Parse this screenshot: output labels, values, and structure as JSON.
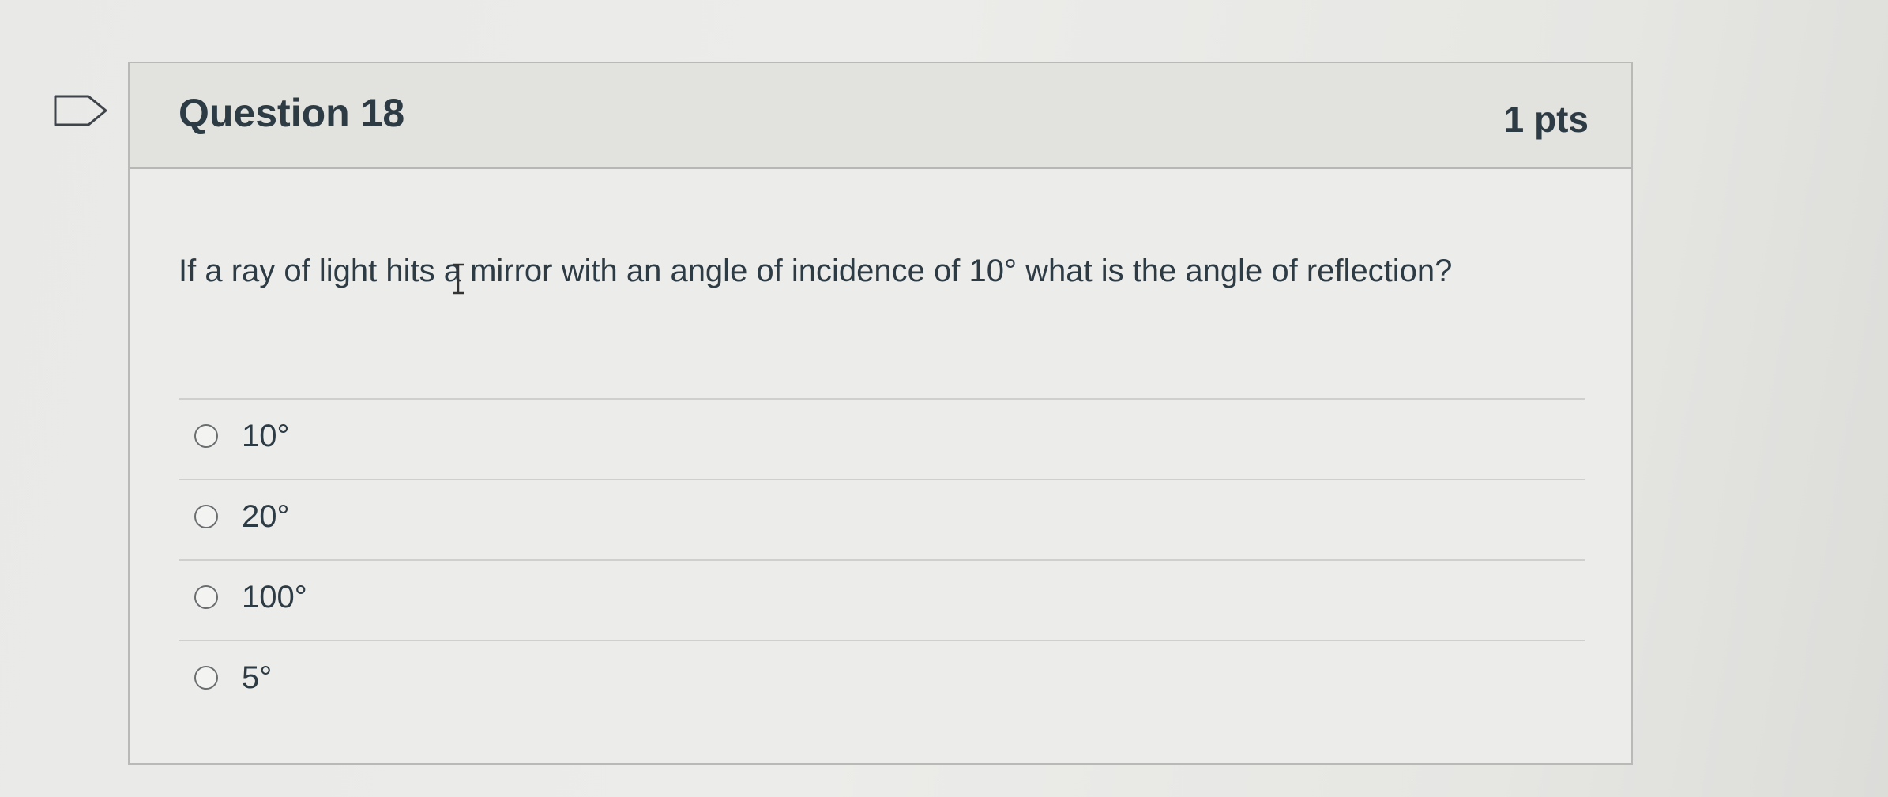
{
  "question": {
    "title": "Question 18",
    "points": "1 pts",
    "text": "If a ray of light hits a mirror with an angle of incidence of 10° what is the angle of reflection?"
  },
  "answers": [
    {
      "label": "10°",
      "selected": false
    },
    {
      "label": "20°",
      "selected": false
    },
    {
      "label": "100°",
      "selected": false
    },
    {
      "label": "5°",
      "selected": false
    }
  ],
  "icons": {
    "flag": "flag-question-icon",
    "radio": "radio-button-icon",
    "cursor": "text-cursor-icon"
  },
  "colors": {
    "text": "#2d3b45",
    "header_background": "#e2e2df",
    "card_background": "#ececea",
    "border": "#b9bab7"
  }
}
